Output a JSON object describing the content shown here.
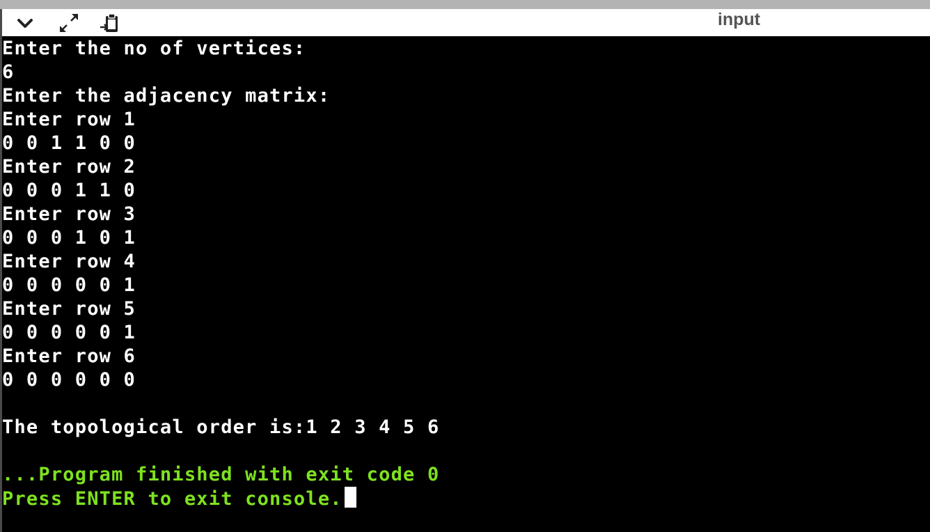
{
  "toolbar": {
    "title": "input",
    "buttons": [
      {
        "icon": "chevron-down-icon"
      },
      {
        "icon": "expand-icon"
      },
      {
        "icon": "clipboard-paste-icon"
      }
    ]
  },
  "console": {
    "lines": [
      {
        "text": "Enter the no of vertices:",
        "color": "#ffffff"
      },
      {
        "text": "6",
        "color": "#ffffff"
      },
      {
        "text": "Enter the adjacency matrix:",
        "color": "#ffffff"
      },
      {
        "text": "Enter row 1",
        "color": "#ffffff"
      },
      {
        "text": "0 0 1 1 0 0",
        "color": "#ffffff"
      },
      {
        "text": "Enter row 2",
        "color": "#ffffff"
      },
      {
        "text": "0 0 0 1 1 0",
        "color": "#ffffff"
      },
      {
        "text": "Enter row 3",
        "color": "#ffffff"
      },
      {
        "text": "0 0 0 1 0 1",
        "color": "#ffffff"
      },
      {
        "text": "Enter row 4",
        "color": "#ffffff"
      },
      {
        "text": "0 0 0 0 0 1",
        "color": "#ffffff"
      },
      {
        "text": "Enter row 5",
        "color": "#ffffff"
      },
      {
        "text": "0 0 0 0 0 1",
        "color": "#ffffff"
      },
      {
        "text": "Enter row 6",
        "color": "#ffffff"
      },
      {
        "text": "0 0 0 0 0 0",
        "color": "#ffffff"
      },
      {
        "text": "",
        "color": "#ffffff"
      },
      {
        "text": "The topological order is:1 2 3 4 5 6",
        "color": "#ffffff"
      },
      {
        "text": "",
        "color": "#ffffff"
      },
      {
        "text": "...Program finished with exit code 0",
        "color": "#7ee21f"
      },
      {
        "text": "Press ENTER to exit console.",
        "color": "#7ee21f"
      }
    ]
  }
}
